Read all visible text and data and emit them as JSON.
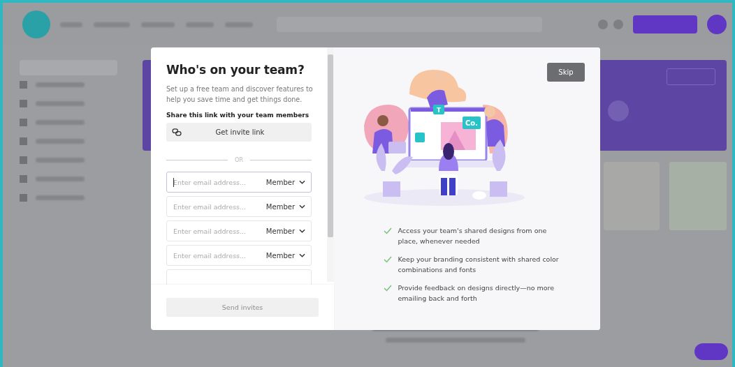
{
  "dialog": {
    "title": "Who's on your team?",
    "description": "Set up a free team and discover features to help you save time and get things done.",
    "share_label": "Share this link with your team members",
    "invite_link_button": "Get invite link",
    "divider_text": "OR",
    "invites": [
      {
        "placeholder": "Enter email address...",
        "role": "Member",
        "focused": true
      },
      {
        "placeholder": "Enter email address...",
        "role": "Member",
        "focused": false
      },
      {
        "placeholder": "Enter email address...",
        "role": "Member",
        "focused": false
      },
      {
        "placeholder": "Enter email address...",
        "role": "Member",
        "focused": false
      }
    ],
    "send_button": {
      "label": "Send invites",
      "disabled": true
    },
    "skip_button": "Skip",
    "illustration_badges": [
      "T",
      "Co."
    ],
    "benefits": [
      "Access your team's shared designs from one place, whenever needed",
      "Keep your branding consistent with shared color combinations and fonts",
      "Provide feedback on designs directly—no more emailing back and forth"
    ]
  }
}
